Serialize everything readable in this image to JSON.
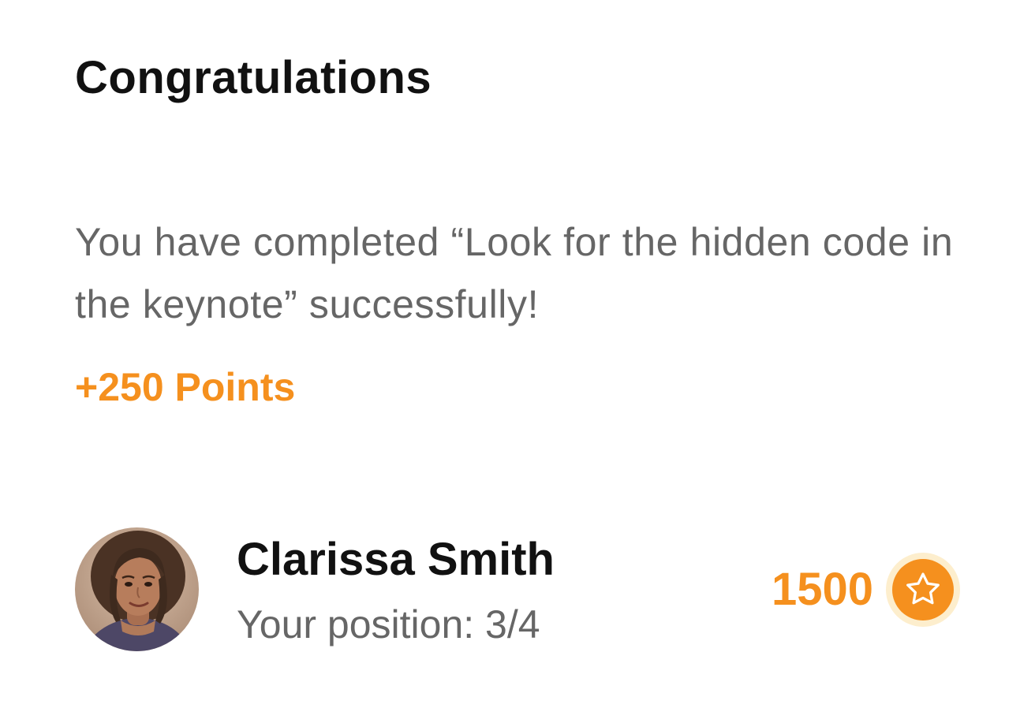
{
  "header": {
    "title": "Congratulations"
  },
  "message": {
    "text": "You have completed “Look for the hidden code in the keynote” successfully!"
  },
  "reward": {
    "points_label": "+250 Points"
  },
  "user": {
    "name": "Clarissa Smith",
    "position_label": "Your position: 3/4",
    "score": "1500",
    "score_icon": "star-icon"
  },
  "colors": {
    "accent": "#f5901e",
    "accent_light": "#fdeecd",
    "title_text": "#111111",
    "body_text": "#666666",
    "background": "#ffffff"
  }
}
